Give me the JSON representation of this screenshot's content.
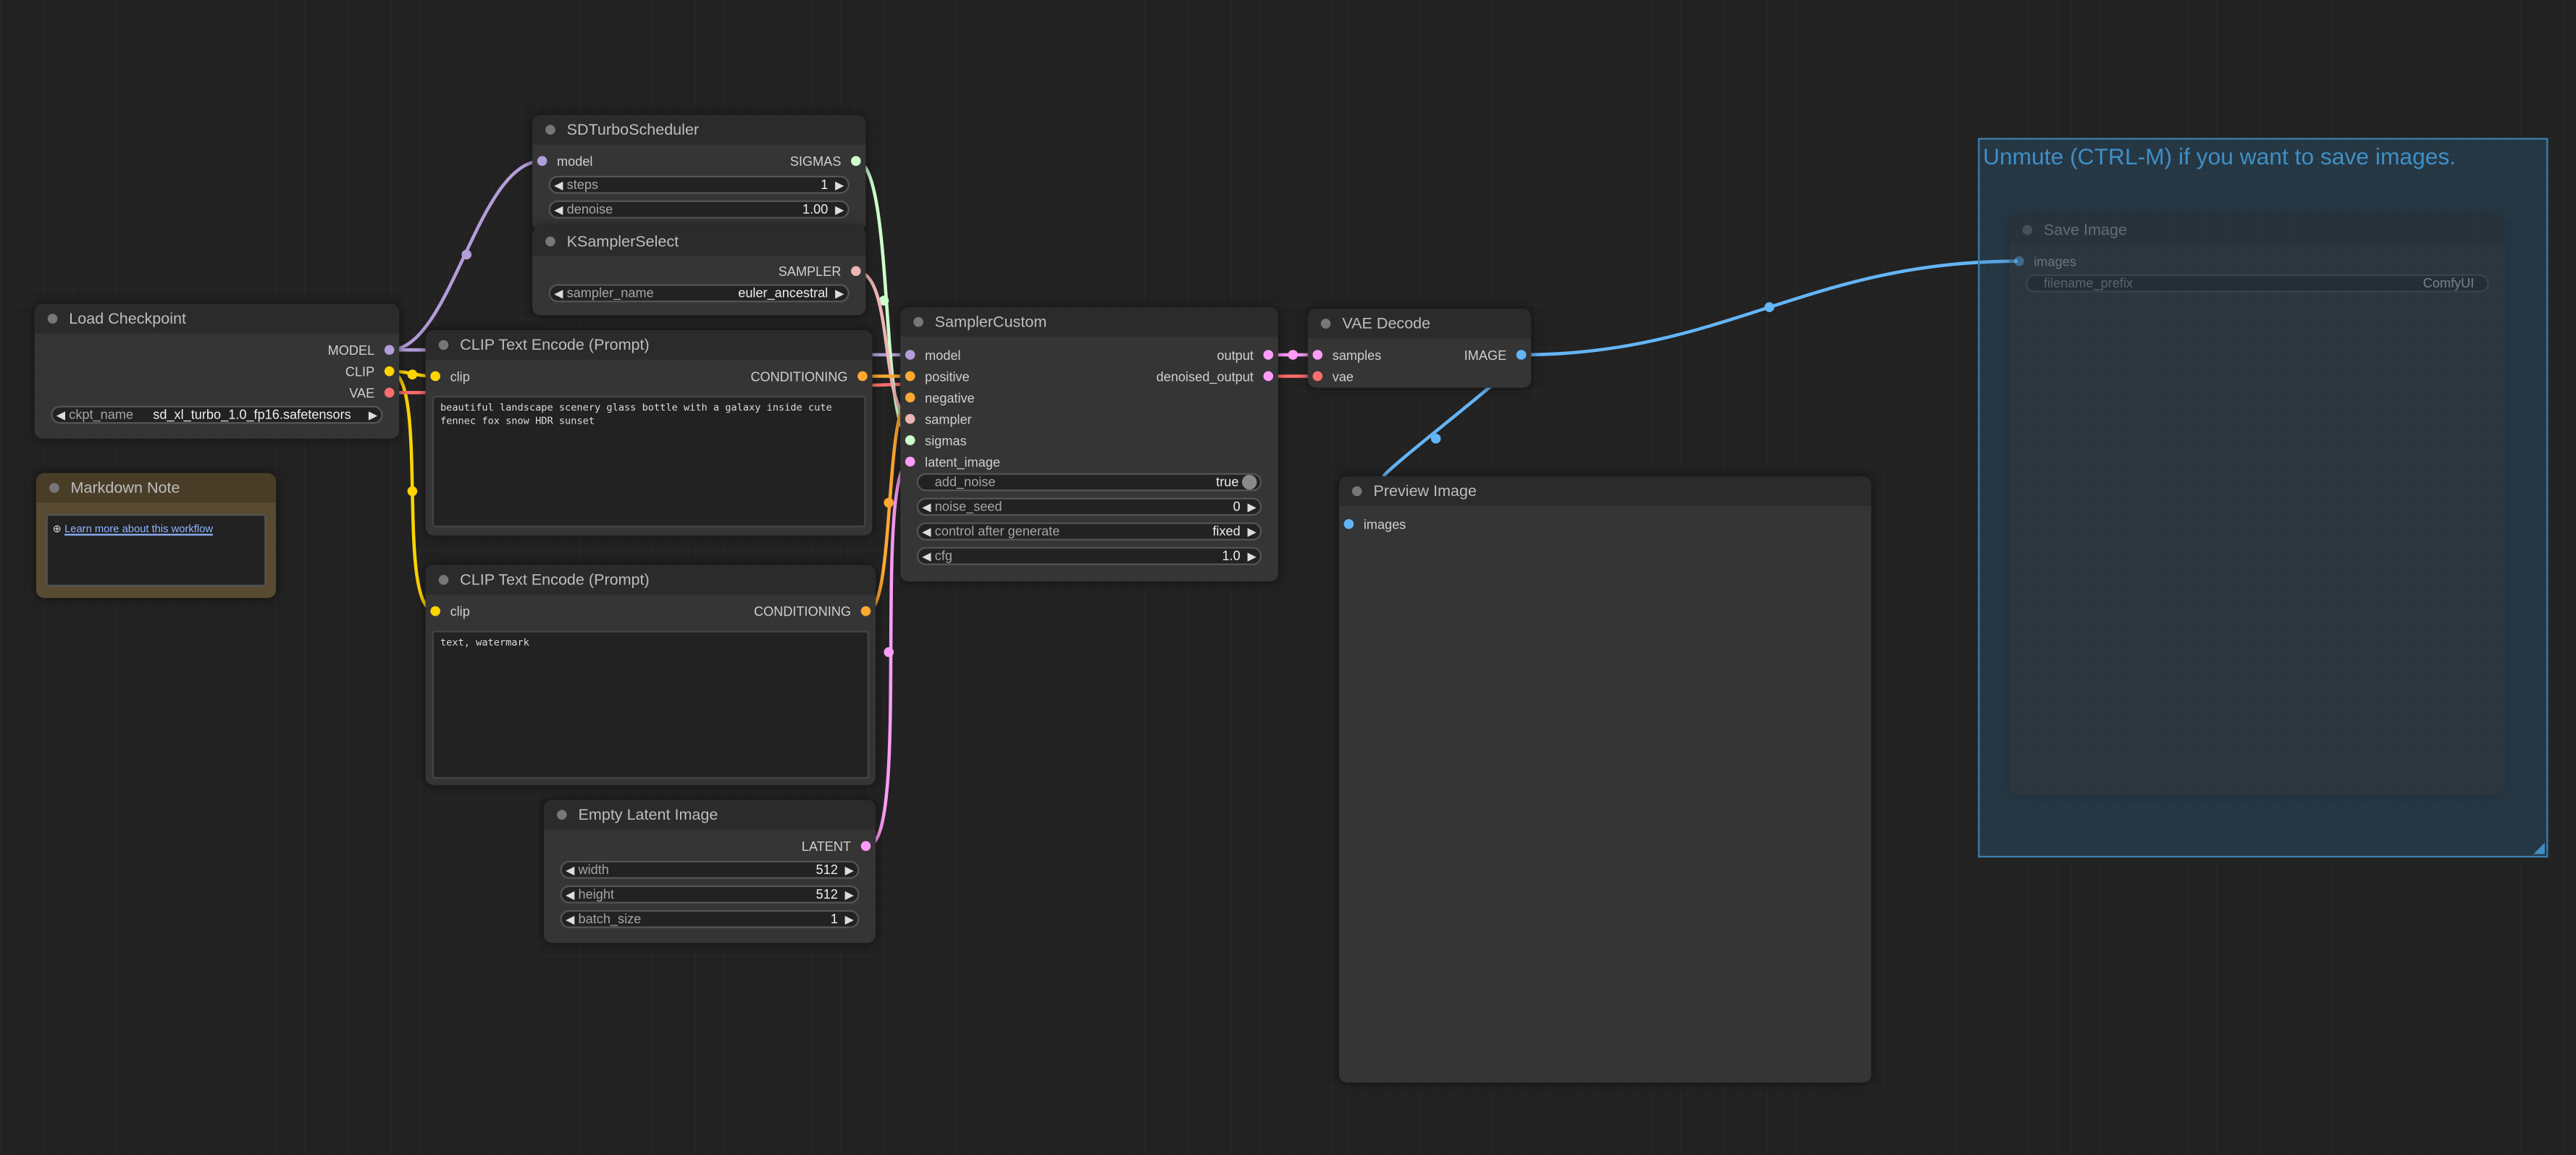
{
  "group": {
    "title": "Unmute (CTRL-M) if you want to save images."
  },
  "nodes": {
    "sd_turbo_scheduler": {
      "title": "SDTurboScheduler",
      "inputs": [
        "model"
      ],
      "outputs": [
        "SIGMAS"
      ],
      "widgets": [
        {
          "name": "steps",
          "value": "1"
        },
        {
          "name": "denoise",
          "value": "1.00"
        }
      ]
    },
    "ksampler_select": {
      "title": "KSamplerSelect",
      "outputs": [
        "SAMPLER"
      ],
      "widgets": [
        {
          "name": "sampler_name",
          "value": "euler_ancestral"
        }
      ]
    },
    "load_checkpoint": {
      "title": "Load Checkpoint",
      "outputs": [
        "MODEL",
        "CLIP",
        "VAE"
      ],
      "widgets": [
        {
          "name": "ckpt_name",
          "value": "sd_xl_turbo_1.0_fp16.safetensors"
        }
      ]
    },
    "clip_text_positive": {
      "title": "CLIP Text Encode (Prompt)",
      "inputs": [
        "clip"
      ],
      "outputs": [
        "CONDITIONING"
      ],
      "text": "beautiful landscape scenery glass bottle with a galaxy inside cute fennec fox snow HDR sunset"
    },
    "clip_text_negative": {
      "title": "CLIP Text Encode (Prompt)",
      "inputs": [
        "clip"
      ],
      "outputs": [
        "CONDITIONING"
      ],
      "text": "text, watermark"
    },
    "sampler_custom": {
      "title": "SamplerCustom",
      "inputs": [
        "model",
        "positive",
        "negative",
        "sampler",
        "sigmas",
        "latent_image"
      ],
      "outputs": [
        "output",
        "denoised_output"
      ],
      "widgets": [
        {
          "name": "add_noise",
          "value": "true"
        },
        {
          "name": "noise_seed",
          "value": "0"
        },
        {
          "name": "control after generate",
          "value": "fixed"
        },
        {
          "name": "cfg",
          "value": "1.0"
        }
      ]
    },
    "vae_decode": {
      "title": "VAE Decode",
      "inputs": [
        "samples",
        "vae"
      ],
      "outputs": [
        "IMAGE"
      ]
    },
    "save_image": {
      "title": "Save Image",
      "inputs": [
        "images"
      ],
      "widgets": [
        {
          "name": "filename_prefix",
          "value": "ComfyUI"
        }
      ]
    },
    "preview_image": {
      "title": "Preview Image",
      "inputs": [
        "images"
      ]
    },
    "markdown_note": {
      "title": "Markdown Note",
      "link_icon": "⊕",
      "link_text": "Learn more about this workflow"
    },
    "empty_latent": {
      "title": "Empty Latent Image",
      "outputs": [
        "LATENT"
      ],
      "widgets": [
        {
          "name": "width",
          "value": "512"
        },
        {
          "name": "height",
          "value": "512"
        },
        {
          "name": "batch_size",
          "value": "1"
        }
      ]
    }
  },
  "colors": {
    "model": "#b39ddb",
    "clip": "#ffd500",
    "vae": "#ff6e6e",
    "conditioning": "#ffa931",
    "latent": "#ff9cf9",
    "image": "#64b5f6",
    "sampler": "#ecb4b4",
    "sigmas": "#cdffcd",
    "group": "#3f8fc6"
  }
}
